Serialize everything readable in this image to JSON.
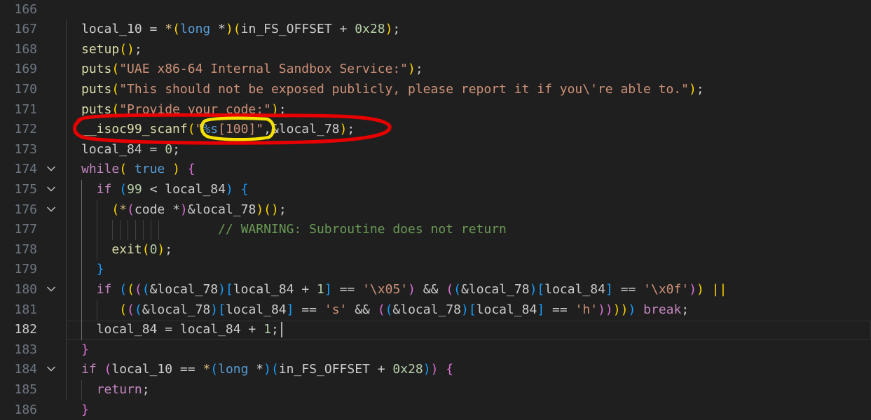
{
  "editor": {
    "active_line": "182",
    "lines": [
      {
        "num": "166",
        "fold": false,
        "tokens": []
      },
      {
        "num": "167",
        "fold": false,
        "tokens": [
          [
            "t",
            "local_10 = "
          ],
          [
            "e",
            "*"
          ],
          [
            "b1",
            "("
          ],
          [
            "k",
            "long"
          ],
          [
            "t",
            " *"
          ],
          [
            "b1",
            ")"
          ],
          [
            "b1",
            "("
          ],
          [
            "t",
            "in_FS_OFFSET + "
          ],
          [
            "n",
            "0x28"
          ],
          [
            "b1",
            ")"
          ],
          [
            "t",
            ";"
          ]
        ]
      },
      {
        "num": "168",
        "fold": false,
        "tokens": [
          [
            "f",
            "setup"
          ],
          [
            "b1",
            "()"
          ],
          [
            "t",
            ";"
          ]
        ]
      },
      {
        "num": "169",
        "fold": false,
        "tokens": [
          [
            "f",
            "puts"
          ],
          [
            "b1",
            "("
          ],
          [
            "s",
            "\"UAE x86-64 Internal Sandbox Service:\""
          ],
          [
            "b1",
            ")"
          ],
          [
            "t",
            ";"
          ]
        ]
      },
      {
        "num": "170",
        "fold": false,
        "tokens": [
          [
            "f",
            "puts"
          ],
          [
            "b1",
            "("
          ],
          [
            "s",
            "\"This should not be exposed publicly, please report it if you\\'re able to.\""
          ],
          [
            "b1",
            ")"
          ],
          [
            "t",
            ";"
          ]
        ]
      },
      {
        "num": "171",
        "fold": false,
        "tokens": [
          [
            "f",
            "puts"
          ],
          [
            "b1",
            "("
          ],
          [
            "s",
            "\"Provide your code:\""
          ],
          [
            "b1",
            ")"
          ],
          [
            "t",
            ";"
          ]
        ]
      },
      {
        "num": "172",
        "fold": false,
        "tokens": [
          [
            "f",
            "__isoc99_scanf"
          ],
          [
            "b1",
            "("
          ],
          [
            "s",
            "\""
          ],
          [
            "k",
            "%s"
          ],
          [
            "s",
            "[100]\""
          ],
          [
            "t",
            ",&local_78"
          ],
          [
            "b1",
            ")"
          ],
          [
            "t",
            ";"
          ]
        ]
      },
      {
        "num": "173",
        "fold": false,
        "tokens": [
          [
            "t",
            "local_84 = "
          ],
          [
            "n",
            "0"
          ],
          [
            "t",
            ";"
          ]
        ]
      },
      {
        "num": "174",
        "fold": true,
        "tokens": [
          [
            "c",
            "while"
          ],
          [
            "b1",
            "("
          ],
          [
            "t",
            " "
          ],
          [
            "k",
            "true"
          ],
          [
            "t",
            " "
          ],
          [
            "b1",
            ")"
          ],
          [
            "t",
            " "
          ],
          [
            "b2",
            "{"
          ]
        ]
      },
      {
        "num": "175",
        "fold": true,
        "tokens": [
          [
            "t",
            "  "
          ],
          [
            "c",
            "if"
          ],
          [
            "t",
            " "
          ],
          [
            "b3",
            "("
          ],
          [
            "n",
            "99"
          ],
          [
            "t",
            " < local_84"
          ],
          [
            "b3",
            ")"
          ],
          [
            "t",
            " "
          ],
          [
            "b3",
            "{"
          ]
        ]
      },
      {
        "num": "176",
        "fold": true,
        "tokens": [
          [
            "t",
            "    "
          ],
          [
            "b1",
            "("
          ],
          [
            "e",
            "*"
          ],
          [
            "b2",
            "("
          ],
          [
            "t",
            "code *"
          ],
          [
            "b2",
            ")"
          ],
          [
            "t",
            "&local_78"
          ],
          [
            "b1",
            ")"
          ],
          [
            "b1",
            "()"
          ],
          [
            "t",
            ";"
          ]
        ]
      },
      {
        "num": "177",
        "fold": false,
        "tokens": [
          [
            "t",
            "                  "
          ],
          [
            "cm",
            "// WARNING: Subroutine does not return"
          ]
        ]
      },
      {
        "num": "178",
        "fold": false,
        "tokens": [
          [
            "t",
            "    "
          ],
          [
            "f",
            "exit"
          ],
          [
            "b1",
            "("
          ],
          [
            "n",
            "0"
          ],
          [
            "b1",
            ")"
          ],
          [
            "t",
            ";"
          ]
        ]
      },
      {
        "num": "179",
        "fold": false,
        "tokens": [
          [
            "t",
            "  "
          ],
          [
            "b3",
            "}"
          ]
        ]
      },
      {
        "num": "180",
        "fold": true,
        "tokens": [
          [
            "t",
            "  "
          ],
          [
            "c",
            "if"
          ],
          [
            "t",
            " "
          ],
          [
            "b3",
            "("
          ],
          [
            "b1",
            "("
          ],
          [
            "b2",
            "("
          ],
          [
            "b3",
            "("
          ],
          [
            "t",
            "&local_78"
          ],
          [
            "b3",
            ")"
          ],
          [
            "b3",
            "["
          ],
          [
            "t",
            "local_84 + "
          ],
          [
            "n",
            "1"
          ],
          [
            "b3",
            "]"
          ],
          [
            "t",
            " == "
          ],
          [
            "s",
            "'\\x05'"
          ],
          [
            "b2",
            ")"
          ],
          [
            "t",
            " && "
          ],
          [
            "b2",
            "("
          ],
          [
            "b3",
            "("
          ],
          [
            "t",
            "&local_78"
          ],
          [
            "b3",
            ")"
          ],
          [
            "b3",
            "["
          ],
          [
            "t",
            "local_84"
          ],
          [
            "b3",
            "]"
          ],
          [
            "t",
            " == "
          ],
          [
            "s",
            "'\\x0f'"
          ],
          [
            "b2",
            ")"
          ],
          [
            "b1",
            ")"
          ],
          [
            "t",
            " "
          ],
          [
            "b1",
            "||"
          ]
        ]
      },
      {
        "num": "181",
        "fold": false,
        "tokens": [
          [
            "t",
            "     "
          ],
          [
            "b1",
            "("
          ],
          [
            "b2",
            "("
          ],
          [
            "b3",
            "("
          ],
          [
            "t",
            "&local_78"
          ],
          [
            "b3",
            ")"
          ],
          [
            "b3",
            "["
          ],
          [
            "t",
            "local_84"
          ],
          [
            "b3",
            "]"
          ],
          [
            "t",
            " == "
          ],
          [
            "s",
            "'s'"
          ],
          [
            "t",
            " && "
          ],
          [
            "b2",
            "("
          ],
          [
            "b3",
            "("
          ],
          [
            "t",
            "&local_78"
          ],
          [
            "b3",
            ")"
          ],
          [
            "b3",
            "["
          ],
          [
            "t",
            "local_84"
          ],
          [
            "b3",
            "]"
          ],
          [
            "t",
            " == "
          ],
          [
            "s",
            "'h'"
          ],
          [
            "b2",
            "))"
          ],
          [
            "b1",
            "))"
          ],
          [
            "b3",
            ")"
          ],
          [
            "t",
            " "
          ],
          [
            "c",
            "break"
          ],
          [
            "t",
            ";"
          ]
        ]
      },
      {
        "num": "182",
        "fold": false,
        "tokens": [
          [
            "t",
            "  local_84 = local_84 + "
          ],
          [
            "n",
            "1"
          ],
          [
            "t",
            ";"
          ]
        ]
      },
      {
        "num": "183",
        "fold": false,
        "tokens": [
          [
            "b2",
            "}"
          ]
        ]
      },
      {
        "num": "184",
        "fold": true,
        "tokens": [
          [
            "c",
            "if"
          ],
          [
            "t",
            " "
          ],
          [
            "b2",
            "("
          ],
          [
            "t",
            "local_10 == "
          ],
          [
            "e",
            "*"
          ],
          [
            "b3",
            "("
          ],
          [
            "k",
            "long"
          ],
          [
            "t",
            " *"
          ],
          [
            "b3",
            ")"
          ],
          [
            "b3",
            "("
          ],
          [
            "t",
            "in_FS_OFFSET + "
          ],
          [
            "n",
            "0x28"
          ],
          [
            "b3",
            ")"
          ],
          [
            "b2",
            ")"
          ],
          [
            "t",
            " "
          ],
          [
            "b2",
            "{"
          ]
        ]
      },
      {
        "num": "185",
        "fold": false,
        "tokens": [
          [
            "t",
            "  "
          ],
          [
            "c",
            "return"
          ],
          [
            "t",
            ";"
          ]
        ]
      },
      {
        "num": "186",
        "fold": false,
        "tokens": [
          [
            "t",
            ""
          ],
          [
            "b2",
            "}"
          ]
        ]
      }
    ]
  }
}
